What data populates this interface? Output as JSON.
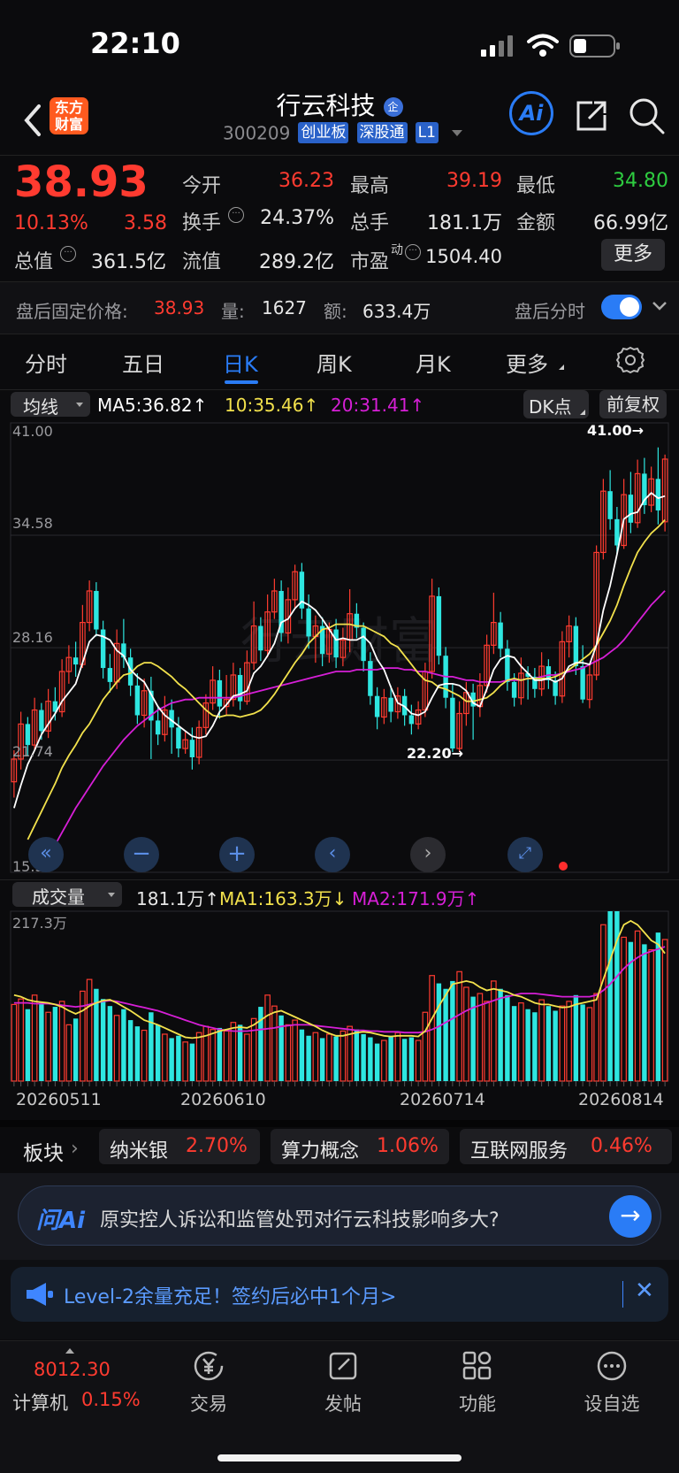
{
  "status_bar": {
    "time": "22:10"
  },
  "header": {
    "logo_text_1": "东方",
    "logo_text_2": "财富",
    "stock_name": "行云科技",
    "badge": "企",
    "stock_code": "300209",
    "tags": [
      "创业板",
      "深股通",
      "L1"
    ],
    "ai_label": "Ai"
  },
  "quote": {
    "price": "38.93",
    "change_pct": "10.13%",
    "change_amt": "3.58",
    "rows": [
      [
        {
          "label": "今开",
          "value": "36.23",
          "color": "#ff3b30"
        },
        {
          "label": "最高",
          "value": "39.19",
          "color": "#ff3b30"
        },
        {
          "label": "最低",
          "value": "34.80",
          "color": "#2ecc40"
        }
      ],
      [
        {
          "label": "换手",
          "value": "24.37%",
          "color": "#e6e6e6"
        },
        {
          "label": "总手",
          "value": "181.1万",
          "color": "#e6e6e6"
        },
        {
          "label": "金额",
          "value": "66.99亿",
          "color": "#e6e6e6"
        }
      ]
    ],
    "total_value_label": "总值",
    "total_value": "361.5亿",
    "float_value_label": "流值",
    "float_value": "289.2亿",
    "pe_label": "市盈",
    "pe_sup": "动",
    "pe_value": "1504.40",
    "more_label": "更多"
  },
  "after_hours": {
    "label": "盘后固定价格:",
    "price": "38.93",
    "vol_label": "量:",
    "vol": "1627",
    "amt_label": "额:",
    "amt": "633.4万",
    "toggle_label": "盘后分时"
  },
  "chart_tabs": [
    "分时",
    "五日",
    "日K",
    "周K",
    "月K",
    "更多"
  ],
  "active_tab": "日K",
  "ma_bar": {
    "selector": "均线",
    "ma5": "MA5:36.82",
    "ma10": "10:35.46",
    "ma20": "20:31.41",
    "dk": "DK点",
    "adjust": "前复权",
    "up_arrow": "↑"
  },
  "kline": {
    "y_labels": [
      "41.00",
      "34.58",
      "28.16",
      "21.74",
      "15.33"
    ],
    "high_mark": "41.00→",
    "low_mark": "22.20→",
    "watermark": "行云财富"
  },
  "volume_bar": {
    "selector": "成交量",
    "vol": "181.1万",
    "ma1": "MA1:163.3万",
    "ma2": "MA2:171.9万",
    "up": "↑",
    "down": "↓",
    "max_label": "217.3万"
  },
  "x_dates": [
    "20260511",
    "20260610",
    "20260714",
    "20260814"
  ],
  "sectors": {
    "label": "板块",
    "items": [
      {
        "name": "纳米银",
        "pct": "2.70%"
      },
      {
        "name": "算力概念",
        "pct": "1.06%"
      },
      {
        "name": "互联网服务",
        "pct": "0.46%"
      }
    ]
  },
  "ask_ai": {
    "brand": "问Ai",
    "question": "原实控人诉讼和监管处罚对行云科技影响多大?"
  },
  "banner": {
    "text": "Level-2余量充足！签约后必中1个月>"
  },
  "bottom_bar": {
    "index_value": "8012.30",
    "index_name": "计算机",
    "index_pct": "0.15%",
    "items": [
      "交易",
      "发帖",
      "功能",
      "设自选"
    ]
  },
  "colors": {
    "up": "#ff3b30",
    "down": "#2ee6e0",
    "ma5": "#ffffff",
    "ma10": "#f2e14c",
    "ma20": "#d61fd6",
    "accent": "#2a7cf6"
  },
  "chart_data": {
    "type": "candlestick",
    "ylim": [
      15.33,
      41.0
    ],
    "y_ticks": [
      41.0,
      34.58,
      28.16,
      21.74,
      15.33
    ],
    "x_ticks": [
      "20260511",
      "20260610",
      "20260714",
      "20260814"
    ],
    "candles": [
      [
        20.5,
        21.8,
        19.6,
        22.3
      ],
      [
        21.8,
        23.8,
        21.2,
        24.5
      ],
      [
        23.8,
        22.6,
        22.0,
        24.2
      ],
      [
        22.6,
        24.6,
        22.3,
        25.3
      ],
      [
        24.6,
        23.4,
        22.9,
        25.0
      ],
      [
        23.4,
        25.1,
        23.0,
        25.8
      ],
      [
        25.1,
        24.5,
        24.0,
        25.9
      ],
      [
        24.5,
        26.8,
        24.2,
        27.5
      ],
      [
        26.8,
        27.6,
        26.1,
        28.3
      ],
      [
        27.6,
        27.2,
        26.5,
        28.5
      ],
      [
        27.2,
        29.6,
        27.0,
        30.6
      ],
      [
        29.6,
        31.4,
        29.1,
        32.0
      ],
      [
        31.4,
        29.2,
        28.8,
        31.9
      ],
      [
        29.2,
        27.0,
        26.4,
        29.7
      ],
      [
        27.0,
        26.2,
        25.6,
        27.8
      ],
      [
        26.2,
        28.4,
        25.8,
        29.2
      ],
      [
        28.4,
        27.6,
        27.0,
        29.8
      ],
      [
        27.6,
        26.0,
        25.4,
        28.1
      ],
      [
        26.0,
        24.3,
        23.8,
        26.7
      ],
      [
        24.3,
        25.7,
        23.6,
        26.4
      ],
      [
        25.7,
        24.0,
        21.8,
        26.5
      ],
      [
        24.0,
        23.2,
        22.6,
        24.8
      ],
      [
        23.2,
        24.6,
        22.8,
        25.4
      ],
      [
        24.6,
        23.6,
        22.1,
        25.2
      ],
      [
        23.6,
        22.4,
        21.9,
        24.2
      ],
      [
        22.4,
        22.9,
        22.1,
        23.4
      ],
      [
        22.9,
        21.9,
        21.2,
        23.6
      ],
      [
        21.9,
        23.6,
        21.5,
        24.0
      ],
      [
        23.6,
        25.0,
        23.2,
        25.5
      ],
      [
        25.0,
        26.3,
        24.6,
        27.1
      ],
      [
        26.3,
        24.8,
        24.1,
        26.9
      ],
      [
        24.8,
        25.2,
        24.3,
        26.6
      ],
      [
        25.2,
        26.6,
        24.8,
        27.3
      ],
      [
        26.6,
        25.1,
        24.6,
        27.0
      ],
      [
        25.1,
        27.3,
        24.9,
        28.0
      ],
      [
        27.3,
        29.4,
        26.9,
        30.8
      ],
      [
        29.4,
        28.0,
        27.4,
        29.9
      ],
      [
        28.0,
        30.2,
        27.6,
        31.2
      ],
      [
        30.2,
        31.4,
        29.8,
        32.1
      ],
      [
        31.4,
        29.0,
        28.5,
        32.0
      ],
      [
        29.0,
        30.9,
        28.4,
        31.6
      ],
      [
        30.9,
        32.5,
        30.4,
        32.9
      ],
      [
        32.5,
        30.4,
        29.8,
        33.0
      ],
      [
        30.4,
        28.8,
        28.1,
        31.2
      ],
      [
        28.8,
        29.4,
        27.3,
        30.0
      ],
      [
        29.4,
        27.8,
        27.1,
        29.9
      ],
      [
        27.8,
        29.2,
        27.3,
        29.6
      ],
      [
        29.2,
        27.6,
        27.0,
        29.8
      ],
      [
        27.6,
        28.6,
        27.1,
        29.3
      ],
      [
        28.6,
        30.1,
        27.9,
        31.5
      ],
      [
        30.1,
        29.3,
        28.7,
        30.7
      ],
      [
        29.3,
        27.4,
        26.8,
        29.6
      ],
      [
        27.4,
        25.4,
        24.9,
        27.9
      ],
      [
        25.4,
        24.2,
        23.5,
        25.9
      ],
      [
        24.2,
        25.3,
        23.8,
        25.8
      ],
      [
        25.3,
        24.5,
        23.9,
        26.0
      ],
      [
        24.5,
        25.4,
        24.1,
        25.9
      ],
      [
        25.4,
        24.3,
        23.7,
        25.8
      ],
      [
        24.3,
        23.8,
        23.2,
        24.9
      ],
      [
        23.8,
        24.6,
        23.5,
        25.1
      ],
      [
        24.6,
        26.8,
        24.2,
        27.3
      ],
      [
        26.8,
        31.1,
        26.4,
        32.1
      ],
      [
        31.1,
        27.7,
        27.2,
        31.6
      ],
      [
        27.7,
        25.3,
        24.7,
        28.2
      ],
      [
        25.3,
        22.4,
        22.2,
        26.1
      ],
      [
        22.4,
        24.4,
        22.2,
        25.1
      ],
      [
        24.4,
        25.6,
        23.7,
        26.2
      ],
      [
        25.6,
        24.8,
        22.9,
        26.1
      ],
      [
        24.8,
        26.0,
        24.2,
        26.7
      ],
      [
        26.0,
        28.3,
        25.6,
        28.9
      ],
      [
        28.3,
        29.6,
        27.8,
        31.3
      ],
      [
        29.6,
        28.1,
        27.6,
        30.2
      ],
      [
        28.1,
        26.2,
        25.7,
        28.6
      ],
      [
        26.2,
        25.3,
        24.8,
        26.7
      ],
      [
        25.3,
        26.7,
        24.9,
        27.6
      ],
      [
        26.7,
        26.5,
        25.2,
        27.1
      ],
      [
        26.5,
        25.8,
        25.3,
        27.0
      ],
      [
        25.8,
        27.1,
        25.4,
        27.9
      ],
      [
        27.1,
        26.3,
        25.8,
        27.5
      ],
      [
        26.3,
        25.4,
        24.9,
        26.8
      ],
      [
        25.4,
        28.5,
        25.0,
        29.1
      ],
      [
        28.5,
        29.4,
        27.6,
        30.0
      ],
      [
        29.4,
        27.1,
        26.6,
        29.9
      ],
      [
        27.1,
        25.2,
        25.0,
        28.3
      ],
      [
        25.2,
        26.6,
        24.7,
        27.2
      ],
      [
        26.6,
        33.6,
        26.3,
        34.0
      ],
      [
        33.6,
        37.1,
        33.2,
        37.8
      ],
      [
        37.1,
        35.5,
        34.9,
        38.3
      ],
      [
        35.5,
        34.0,
        33.5,
        36.2
      ],
      [
        34.0,
        36.9,
        33.8,
        37.8
      ],
      [
        36.9,
        35.3,
        34.7,
        38.2
      ],
      [
        35.3,
        38.1,
        35.0,
        38.9
      ],
      [
        38.1,
        36.3,
        35.8,
        39.0
      ],
      [
        36.3,
        37.8,
        35.9,
        38.5
      ],
      [
        37.8,
        36.0,
        35.2,
        39.6
      ],
      [
        35.35,
        38.93,
        34.8,
        39.19
      ]
    ],
    "ma5": [
      19.0,
      20.3,
      21.5,
      22.3,
      23.2,
      23.8,
      24.4,
      25.1,
      25.6,
      26.1,
      27.3,
      28.5,
      28.9,
      28.8,
      28.6,
      28.0,
      27.7,
      26.9,
      26.5,
      26.2,
      25.5,
      24.8,
      24.3,
      24.0,
      23.7,
      23.4,
      23.1,
      23.0,
      23.1,
      23.7,
      24.5,
      24.9,
      25.4,
      25.5,
      25.7,
      26.7,
      27.1,
      27.7,
      28.4,
      29.6,
      29.8,
      30.4,
      30.8,
      30.6,
      30.3,
      29.8,
      29.2,
      28.6,
      28.7,
      28.6,
      28.6,
      28.8,
      28.4,
      27.5,
      26.9,
      25.9,
      25.0,
      24.8,
      24.4,
      24.3,
      24.5,
      25.3,
      26.0,
      26.1,
      26.1,
      26.0,
      25.7,
      25.0,
      24.8,
      25.8,
      26.9,
      27.5,
      27.7,
      27.6,
      27.1,
      26.7,
      26.3,
      26.3,
      26.4,
      26.2,
      26.4,
      27.1,
      27.3,
      27.3,
      27.2,
      28.3,
      30.3,
      31.7,
      33.5,
      35.5,
      35.8,
      35.9,
      36.6,
      37.0,
      36.7,
      36.82
    ],
    "ma10": [
      17.2,
      18.0,
      18.8,
      19.6,
      20.4,
      21.3,
      22.0,
      22.6,
      23.3,
      23.8,
      24.5,
      25.2,
      25.7,
      26.2,
      26.6,
      26.7,
      27.1,
      27.3,
      27.3,
      27.1,
      26.8,
      26.5,
      26.1,
      25.8,
      25.4,
      25.0,
      24.6,
      24.3,
      24.2,
      24.3,
      24.3,
      24.2,
      24.3,
      24.4,
      24.6,
      25.0,
      25.5,
      26.1,
      26.7,
      27.3,
      27.8,
      28.4,
      28.8,
      29.2,
      29.3,
      29.5,
      29.5,
      29.5,
      29.4,
      29.4,
      29.2,
      29.0,
      28.8,
      28.4,
      28.2,
      27.7,
      27.2,
      26.7,
      26.3,
      26.2,
      25.9,
      25.8,
      25.6,
      25.4,
      25.1,
      25.1,
      25.2,
      25.3,
      25.6,
      26.0,
      26.3,
      26.4,
      26.3,
      26.4,
      26.4,
      26.4,
      26.4,
      26.5,
      26.7,
      26.9,
      27.2,
      27.5,
      27.8,
      28.3,
      29.0,
      29.7,
      30.6,
      31.7,
      32.7,
      33.6,
      34.2,
      34.7,
      35.05,
      35.46
    ],
    "ma20": [
      15.5,
      16.2,
      16.9,
      17.6,
      18.3,
      19.0,
      19.6,
      20.2,
      20.8,
      21.4,
      21.9,
      22.4,
      22.9,
      23.3,
      23.7,
      24.0,
      24.3,
      24.6,
      24.8,
      25.0,
      25.1,
      25.2,
      25.2,
      25.3,
      25.3,
      25.3,
      25.3,
      25.3,
      25.3,
      25.4,
      25.5,
      25.6,
      25.7,
      25.8,
      25.9,
      26.0,
      26.1,
      26.2,
      26.3,
      26.4,
      26.5,
      26.6,
      26.7,
      26.8,
      26.8,
      26.8,
      26.9,
      26.9,
      26.9,
      26.9,
      27.0,
      27.0,
      27.0,
      26.9,
      26.9,
      26.8,
      26.8,
      26.7,
      26.6,
      26.5,
      26.5,
      26.4,
      26.3,
      26.3,
      26.2,
      26.2,
      26.2,
      26.2,
      26.3,
      26.3,
      26.3,
      26.4,
      26.4,
      26.5,
      26.6,
      26.6,
      26.7,
      26.8,
      26.9,
      27.0,
      27.2,
      27.4,
      27.6,
      27.9,
      28.2,
      28.6,
      29.1,
      29.6,
      30.1,
      30.6,
      31.0,
      31.41
    ],
    "volume_max": 217.3,
    "volumes": [
      98,
      105,
      92,
      110,
      100,
      88,
      95,
      102,
      72,
      80,
      115,
      130,
      118,
      105,
      96,
      84,
      92,
      78,
      70,
      65,
      88,
      72,
      60,
      55,
      58,
      50,
      48,
      62,
      70,
      66,
      68,
      64,
      75,
      72,
      60,
      80,
      95,
      110,
      96,
      84,
      72,
      78,
      66,
      58,
      62,
      55,
      60,
      57,
      64,
      70,
      66,
      60,
      56,
      48,
      52,
      58,
      62,
      54,
      56,
      52,
      88,
      135,
      125,
      118,
      128,
      140,
      120,
      108,
      112,
      102,
      128,
      118,
      110,
      96,
      100,
      92,
      88,
      104,
      96,
      90,
      96,
      102,
      110,
      98,
      94,
      112,
      200,
      228,
      230,
      184,
      178,
      192,
      175,
      168,
      190,
      181.1
    ],
    "vol_ma1": [
      110,
      108,
      104,
      102,
      101,
      100,
      98,
      95,
      90,
      86,
      90,
      96,
      100,
      103,
      104,
      100,
      95,
      90,
      84,
      78,
      75,
      72,
      68,
      64,
      60,
      56,
      55,
      56,
      58,
      61,
      64,
      66,
      68,
      69,
      68,
      72,
      78,
      84,
      88,
      90,
      86,
      82,
      78,
      74,
      70,
      65,
      61,
      58,
      58,
      60,
      62,
      63,
      62,
      60,
      58,
      57,
      58,
      58,
      58,
      57,
      64,
      80,
      96,
      110,
      124,
      126,
      128,
      126,
      120,
      116,
      118,
      116,
      114,
      110,
      108,
      104,
      100,
      98,
      98,
      96,
      94,
      95,
      98,
      100,
      102,
      104,
      130,
      155,
      180,
      200,
      205,
      200,
      190,
      180,
      175,
      163.3
    ],
    "vol_ma2": [
      100,
      100,
      100,
      99,
      99,
      99,
      98,
      97,
      96,
      95,
      96,
      98,
      100,
      102,
      103,
      102,
      100,
      98,
      96,
      94,
      92,
      90,
      87,
      84,
      81,
      78,
      75,
      72,
      70,
      68,
      66,
      65,
      64,
      64,
      64,
      65,
      66,
      67,
      68,
      70,
      71,
      72,
      72,
      72,
      71,
      70,
      69,
      68,
      67,
      66,
      65,
      65,
      64,
      64,
      63,
      63,
      63,
      62,
      62,
      62,
      63,
      66,
      70,
      75,
      80,
      85,
      90,
      94,
      97,
      100,
      103,
      106,
      108,
      110,
      112,
      112,
      112,
      111,
      110,
      109,
      108,
      108,
      108,
      108,
      108,
      110,
      116,
      124,
      134,
      144,
      152,
      158,
      163,
      166,
      169,
      171.9
    ]
  }
}
